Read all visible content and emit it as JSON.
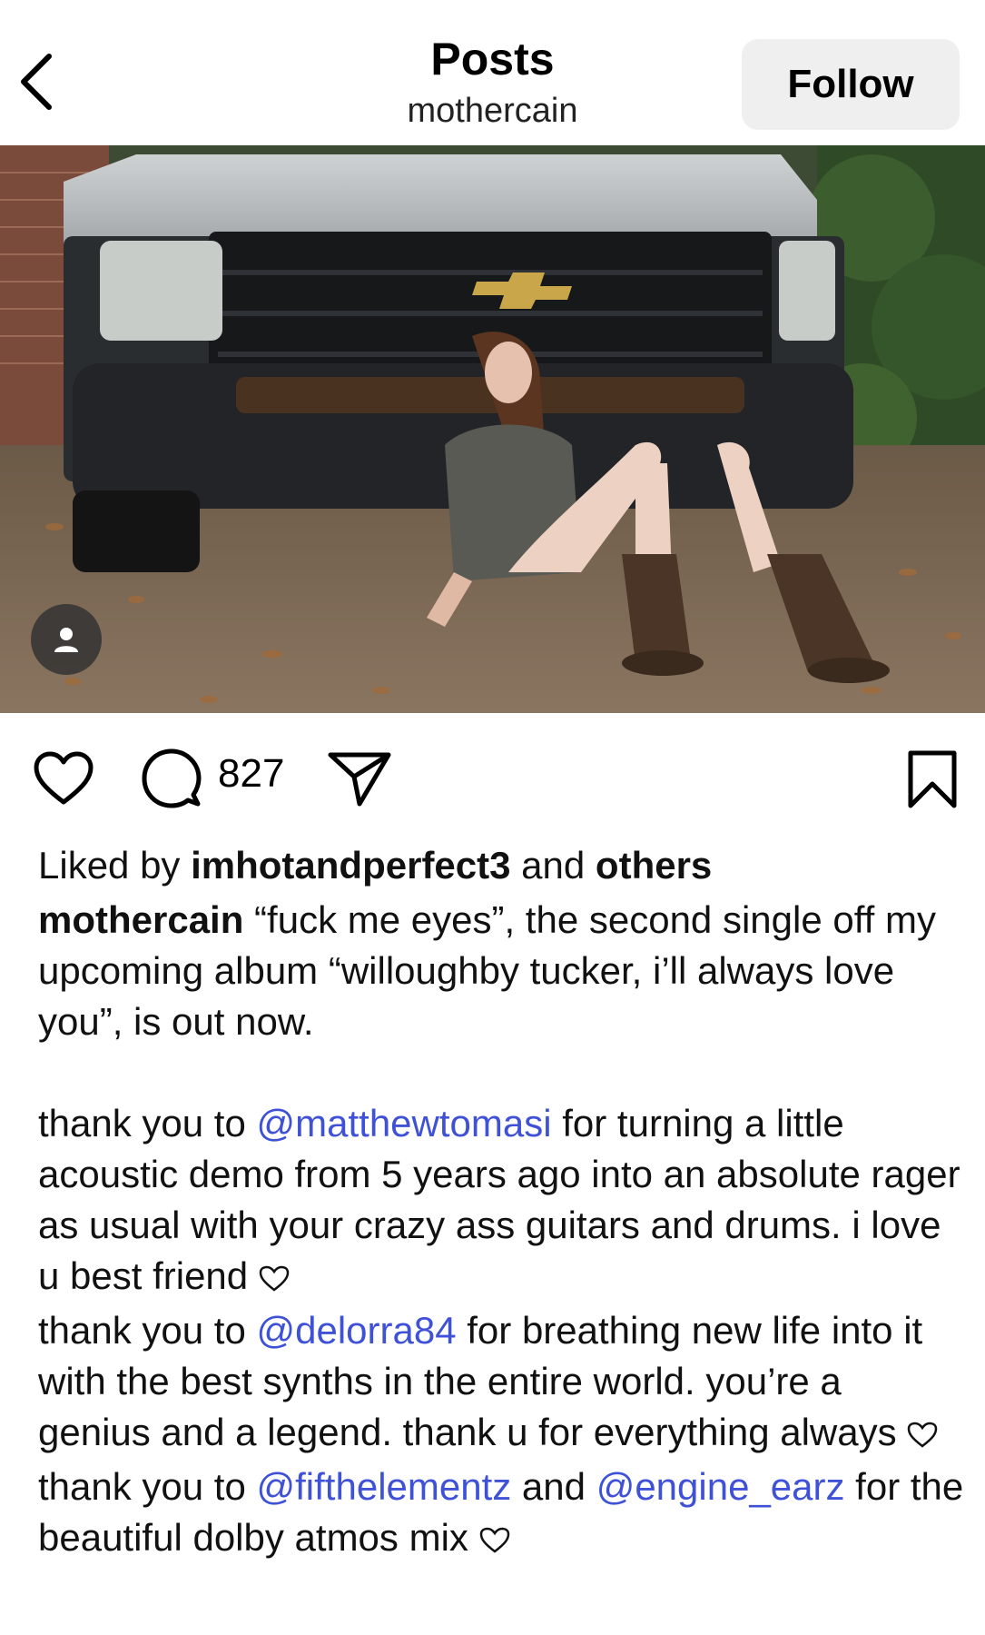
{
  "header": {
    "title": "Posts",
    "username": "mothercain",
    "follow_label": "Follow"
  },
  "post": {
    "comment_count": "827",
    "liked_by_prefix": "Liked by ",
    "liked_by_user": "imhotandperfect3",
    "liked_by_and": " and ",
    "liked_by_others": "others",
    "caption_author": "mothercain",
    "caption_intro": " “fuck me eyes”, the second single off my upcoming album “willoughby tucker, i’ll always love you”, is out now.",
    "thanks_1_pre": "thank you to ",
    "thanks_1_mention": "@matthewtomasi",
    "thanks_1_post": " for turning a little acoustic demo from 5 years ago into an absolute rager as usual with your crazy ass guitars and drums. i love u best friend ",
    "thanks_2_pre": "thank you to ",
    "thanks_2_mention": "@delorra84",
    "thanks_2_post": " for breathing new life into it with the best synths in the entire world. you’re a genius and a legend. thank u for everything always ",
    "thanks_3_pre": "thank you to ",
    "thanks_3_mention_a": "@fifthelementz",
    "thanks_3_mid": " and ",
    "thanks_3_mention_b": "@engine_earz",
    "thanks_3_post": " for the beautiful dolby atmos mix "
  },
  "icons": {
    "back": "chevron-left-icon",
    "like": "heart-icon",
    "comment": "comment-bubble-icon",
    "share": "paper-plane-icon",
    "save": "bookmark-icon",
    "tag": "user-tag-icon"
  },
  "colors": {
    "mention": "#3f51d6",
    "follow_bg": "#efefef"
  }
}
